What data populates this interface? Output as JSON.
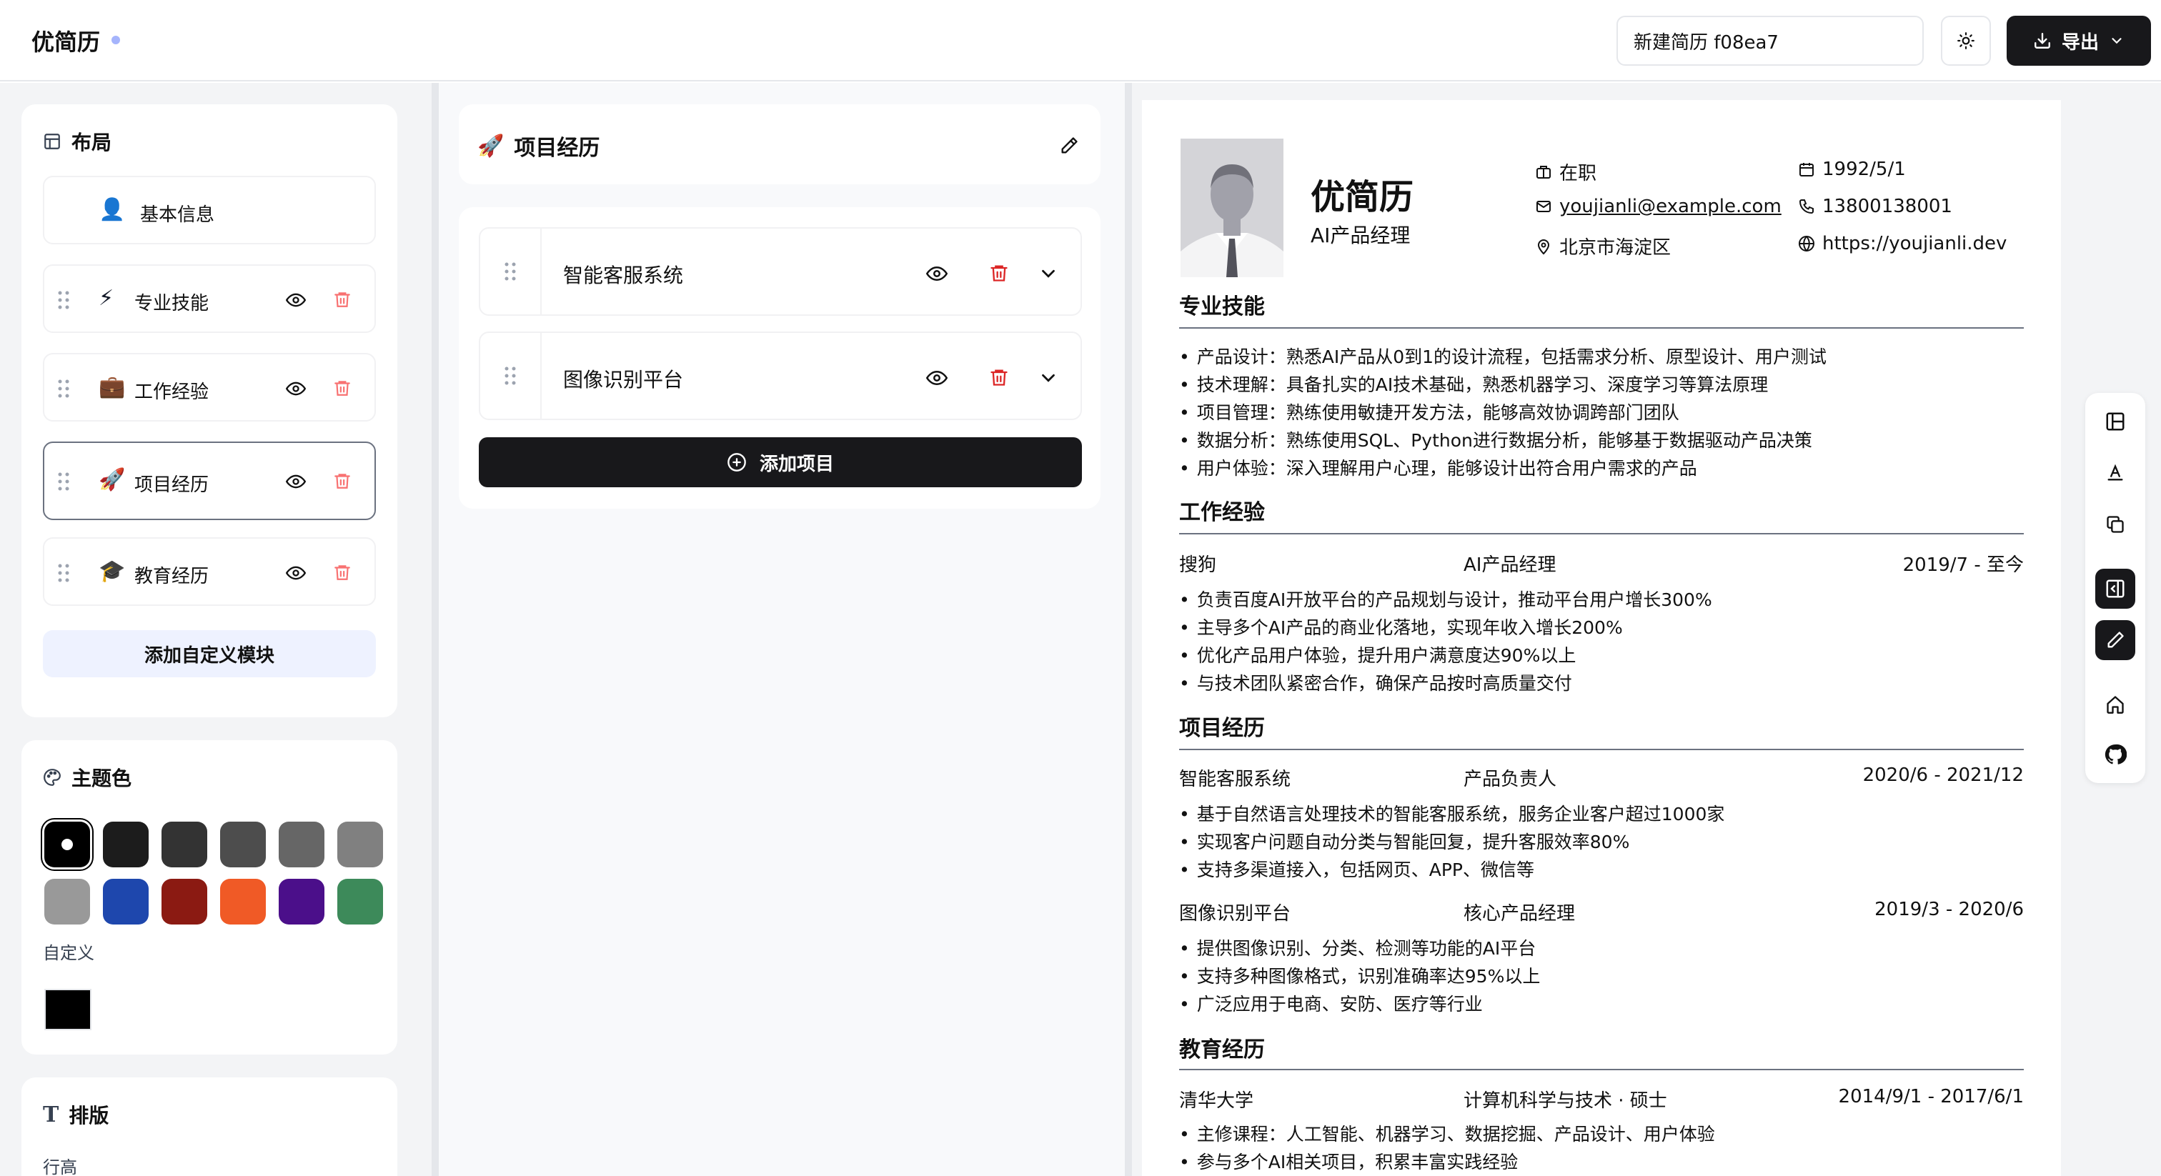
{
  "header": {
    "logo": "优简历",
    "resume_title": "新建简历 f08ea7",
    "export_label": "导出"
  },
  "layout_panel": {
    "title": "布局",
    "modules": [
      {
        "emoji": "👤",
        "label": "基本信息"
      },
      {
        "emoji": "⚡",
        "label": "专业技能"
      },
      {
        "emoji": "💼",
        "label": "工作经验"
      },
      {
        "emoji": "🚀",
        "label": "项目经历"
      },
      {
        "emoji": "🎓",
        "label": "教育经历"
      }
    ],
    "add_custom_label": "添加自定义模块"
  },
  "theme_panel": {
    "title": "主题色",
    "colors": [
      "#000000",
      "#1c1c1c",
      "#333333",
      "#4d4d4d",
      "#666666",
      "#808080",
      "#999999",
      "#1e47ad",
      "#8b1a12",
      "#f05a26",
      "#4b0f8a",
      "#3d8a5a"
    ],
    "custom_label": "自定义",
    "custom_color": "#000000"
  },
  "typography_panel": {
    "title": "排版",
    "line_height_label": "行高"
  },
  "editor": {
    "title": "项目经历",
    "title_emoji": "🚀",
    "items": [
      {
        "name": "智能客服系统"
      },
      {
        "name": "图像识别平台"
      }
    ],
    "add_label": "添加项目"
  },
  "resume": {
    "name": "优简历",
    "role": "AI产品经理",
    "info": {
      "status": "在职",
      "birthday": "1992/5/1",
      "email": "youjianli@example.com",
      "phone": "13800138001",
      "location": "北京市海淀区",
      "website": "https://youjianli.dev"
    },
    "skills": {
      "title": "专业技能",
      "items": [
        "产品设计：熟悉AI产品从0到1的设计流程，包括需求分析、原型设计、用户测试",
        "技术理解：具备扎实的AI技术基础，熟悉机器学习、深度学习等算法原理",
        "项目管理：熟练使用敏捷开发方法，能够高效协调跨部门团队",
        "数据分析：熟练使用SQL、Python进行数据分析，能够基于数据驱动产品决策",
        "用户体验：深入理解用户心理，能够设计出符合用户需求的产品"
      ]
    },
    "work": {
      "title": "工作经验",
      "entries": [
        {
          "company": "搜狗",
          "position": "AI产品经理",
          "date": "2019/7 - 至今",
          "items": [
            "负责百度AI开放平台的产品规划与设计，推动平台用户增长300%",
            "主导多个AI产品的商业化落地，实现年收入增长200%",
            "优化产品用户体验，提升用户满意度达90%以上",
            "与技术团队紧密合作，确保产品按时高质量交付"
          ]
        }
      ]
    },
    "projects": {
      "title": "项目经历",
      "entries": [
        {
          "name": "智能客服系统",
          "role": "产品负责人",
          "date": "2020/6 - 2021/12",
          "items": [
            "基于自然语言处理技术的智能客服系统，服务企业客户超过1000家",
            "实现客户问题自动分类与智能回复，提升客服效率80%",
            "支持多渠道接入，包括网页、APP、微信等"
          ]
        },
        {
          "name": "图像识别平台",
          "role": "核心产品经理",
          "date": "2019/3 - 2020/6",
          "items": [
            "提供图像识别、分类、检测等功能的AI平台",
            "支持多种图像格式，识别准确率达95%以上",
            "广泛应用于电商、安防、医疗等行业"
          ]
        }
      ]
    },
    "education": {
      "title": "教育经历",
      "entries": [
        {
          "school": "清华大学",
          "major": "计算机科学与技术 · 硕士",
          "date": "2014/9/1 - 2017/6/1",
          "items": [
            "主修课程：人工智能、机器学习、数据挖掘、产品设计、用户体验",
            "参与多个AI相关项目，积累丰富实践经验"
          ]
        }
      ]
    }
  }
}
